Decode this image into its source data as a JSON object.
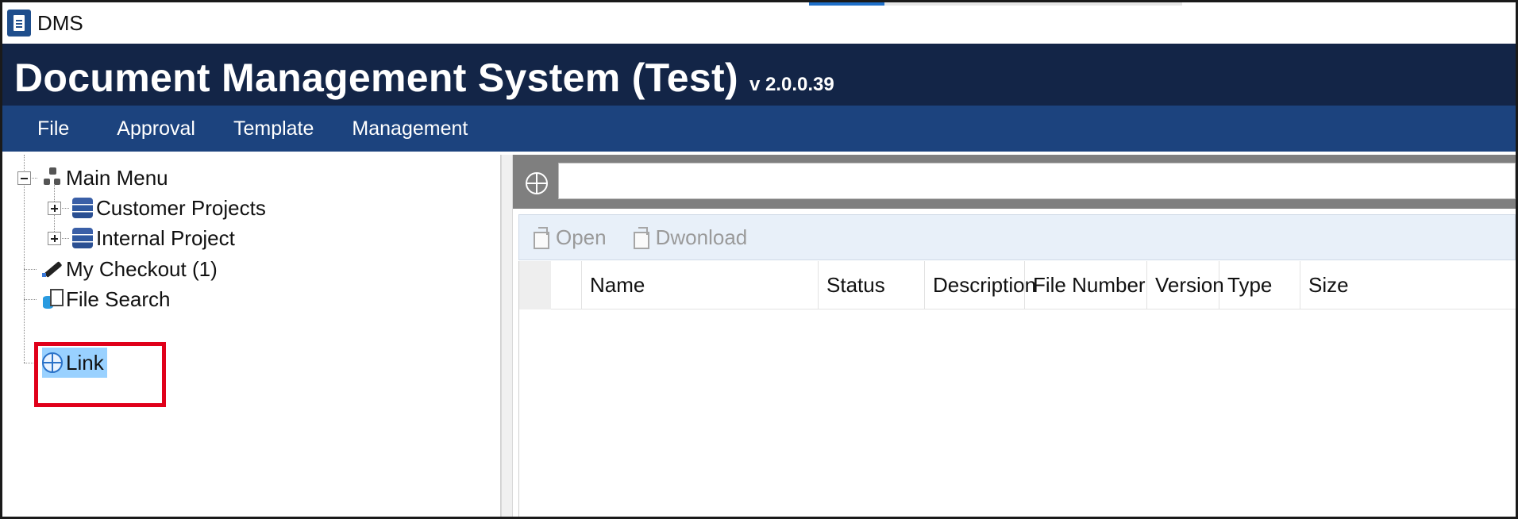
{
  "window": {
    "title": "DMS"
  },
  "header": {
    "app_name": "Document Management System (Test)",
    "version": "v 2.0.0.39"
  },
  "menu": {
    "items": [
      "File",
      "Approval",
      "Template",
      "Management"
    ]
  },
  "tree": {
    "root": {
      "label": "Main Menu",
      "icon": "sitemap-icon"
    },
    "children": [
      {
        "label": "Customer Projects",
        "icon": "cabinet-icon",
        "expandable": true
      },
      {
        "label": "Internal Project",
        "icon": "cabinet-icon",
        "expandable": true
      }
    ],
    "items": [
      {
        "label": "My Checkout  (1)",
        "icon": "pen-icon"
      },
      {
        "label": "File Search",
        "icon": "file-search-icon"
      },
      {
        "label": "Link",
        "icon": "link-globe-icon",
        "selected": true
      }
    ]
  },
  "address": {
    "value": "",
    "icon": "globe-icon"
  },
  "toolbar": {
    "open_label": "Open",
    "download_label": "Dwonload"
  },
  "grid": {
    "columns": [
      "Name",
      "Status",
      "Description",
      "File Number",
      "Version",
      "Type",
      "Size"
    ],
    "rows": []
  },
  "colors": {
    "header_bg": "#132547",
    "menu_bg": "#1c437e",
    "selection": "#99d1ff",
    "highlight": "#e0001a"
  }
}
